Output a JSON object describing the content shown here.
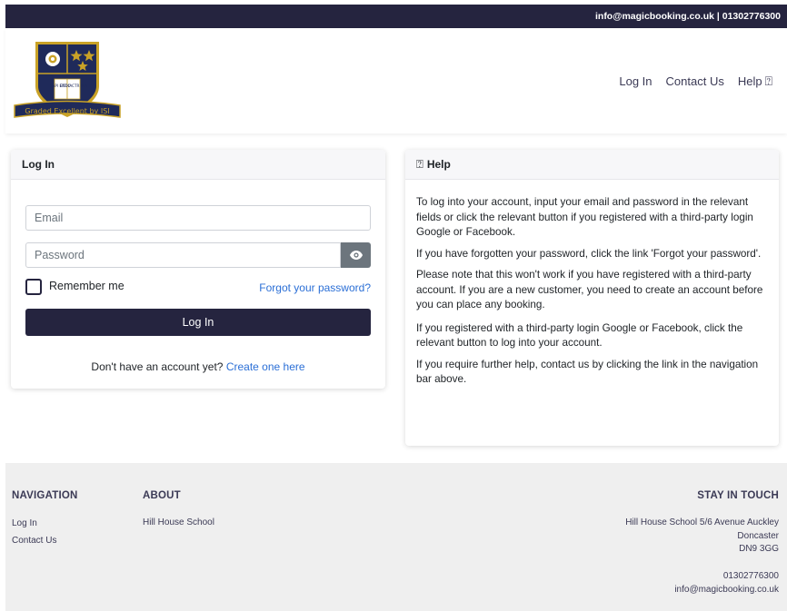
{
  "topbar": {
    "contact": "info@magicbooking.co.uk | 01302776300"
  },
  "logo": {
    "book_left": "SAPI ENT IA",
    "book_right": "ETDO CTR INA",
    "banner": "Graded Excellent by ISI",
    "colors": {
      "navy": "#1f2a5a",
      "gold": "#c9a227"
    }
  },
  "nav": {
    "login": "Log In",
    "contact": "Contact Us",
    "help": "Help",
    "help_icon": "question-icon"
  },
  "login_card": {
    "title": "Log In",
    "email_placeholder": "Email",
    "password_placeholder": "Password",
    "remember_label": "Remember me",
    "remember_checked": false,
    "forgot_link": "Forgot your password?",
    "submit_label": "Log In",
    "signup_prompt": "Don't have an account yet?",
    "signup_link": "Create one here"
  },
  "help_card": {
    "title": "Help",
    "paragraphs": [
      "To log into your account, input your email and password in the relevant fields or click the relevant button if you registered with a third-party login Google or Facebook.",
      "If you have forgotten your password, click the link 'Forgot your password'.",
      "Please note that this won't work if you have registered with a third-party account. If you are a new customer, you need to create an account before you can place any booking.",
      "If you registered with a third-party login Google or Facebook, click the relevant button to log into your account.",
      "If you require further help, contact us by clicking the link in the navigation bar above."
    ]
  },
  "footer": {
    "navigation": {
      "heading": "NAVIGATION",
      "links": [
        "Log In",
        "Contact Us"
      ]
    },
    "about": {
      "heading": "ABOUT",
      "text": "Hill House School"
    },
    "stay_in_touch": {
      "heading": "STAY IN TOUCH",
      "address_lines": [
        "Hill House School 5/6 Avenue Auckley",
        "Doncaster",
        "DN9 3GG"
      ],
      "phone": "01302776300",
      "email": "info@magicbooking.co.uk"
    }
  },
  "colors": {
    "primary": "#25243f",
    "link": "#2b6fd6",
    "footer_bg": "#efefef"
  }
}
